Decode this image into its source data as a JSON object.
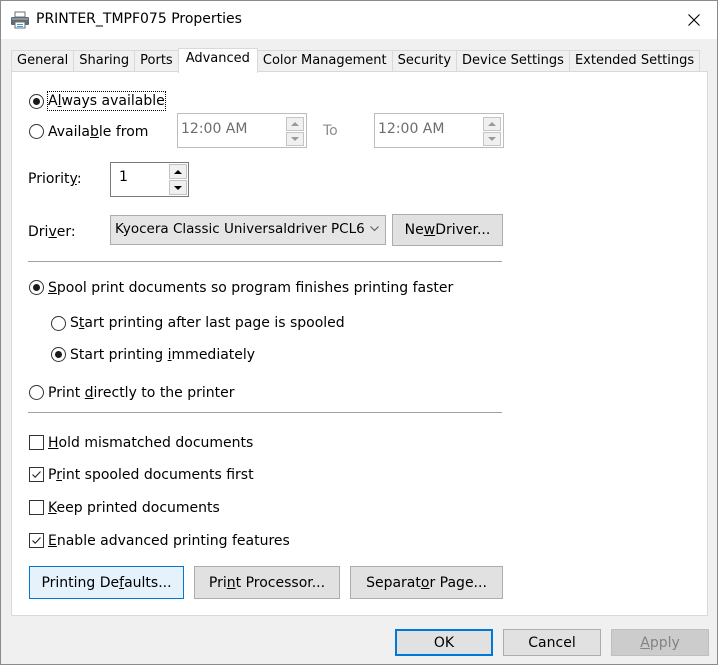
{
  "window": {
    "title": "PRINTER_TMPF075 Properties",
    "icon": "printer-icon",
    "close_icon": "close-icon"
  },
  "tabs": [
    {
      "label": "General",
      "active": false
    },
    {
      "label": "Sharing",
      "active": false
    },
    {
      "label": "Ports",
      "active": false
    },
    {
      "label": "Advanced",
      "active": true
    },
    {
      "label": "Color Management",
      "active": false
    },
    {
      "label": "Security",
      "active": false
    },
    {
      "label": "Device Settings",
      "active": false
    },
    {
      "label": "Extended Settings",
      "active": false
    }
  ],
  "availability": {
    "always_available": {
      "label_pre": "A",
      "label_u": "l",
      "label_post": "ways available",
      "checked": true
    },
    "available_from": {
      "label_pre": "Availa",
      "label_u": "b",
      "label_post": "le from",
      "checked": false
    },
    "from_time": "12:00 AM",
    "to_label": "To",
    "to_time": "12:00 AM"
  },
  "priority": {
    "label_pre": "Priorit",
    "label_u": "y",
    "label_post": ":",
    "value": "1"
  },
  "driver": {
    "label_pre": "Dri",
    "label_u": "v",
    "label_post": "er:",
    "selected": "Kyocera Classic Universaldriver PCL6",
    "new_driver_pre": "Ne",
    "new_driver_u": "w",
    "new_driver_post": " Driver..."
  },
  "spooling": {
    "spool": {
      "label_pre": "",
      "label_u": "S",
      "label_post": "pool print documents so program finishes printing faster",
      "checked": true
    },
    "after_last_page": {
      "label_pre": "S",
      "label_u": "t",
      "label_post": "art printing after last page is spooled",
      "checked": false
    },
    "immediately": {
      "label_pre": "Start printing ",
      "label_u": "i",
      "label_post": "mmediately",
      "checked": true
    },
    "direct": {
      "label_pre": "Print ",
      "label_u": "d",
      "label_post": "irectly to the printer",
      "checked": false
    }
  },
  "options": [
    {
      "label_pre": "",
      "label_u": "H",
      "label_post": "old mismatched documents",
      "checked": false
    },
    {
      "label_pre": "P",
      "label_u": "r",
      "label_post": "int spooled documents first",
      "checked": true
    },
    {
      "label_pre": "",
      "label_u": "K",
      "label_post": "eep printed documents",
      "checked": false
    },
    {
      "label_pre": "",
      "label_u": "E",
      "label_post": "nable advanced printing features",
      "checked": true
    }
  ],
  "panel_buttons": {
    "printing_defaults": {
      "pre": "Printing De",
      "u": "f",
      "post": "aults..."
    },
    "print_processor": {
      "pre": "Pri",
      "u": "n",
      "post": "t Processor..."
    },
    "separator_page": {
      "pre": "Separat",
      "u": "o",
      "post": "r Page..."
    }
  },
  "footer": {
    "ok": "OK",
    "cancel": "Cancel",
    "apply_u": "A",
    "apply_post": "pply"
  },
  "colors": {
    "accent": "#0078d7",
    "hot_button_bg": "#e5f1fb"
  }
}
